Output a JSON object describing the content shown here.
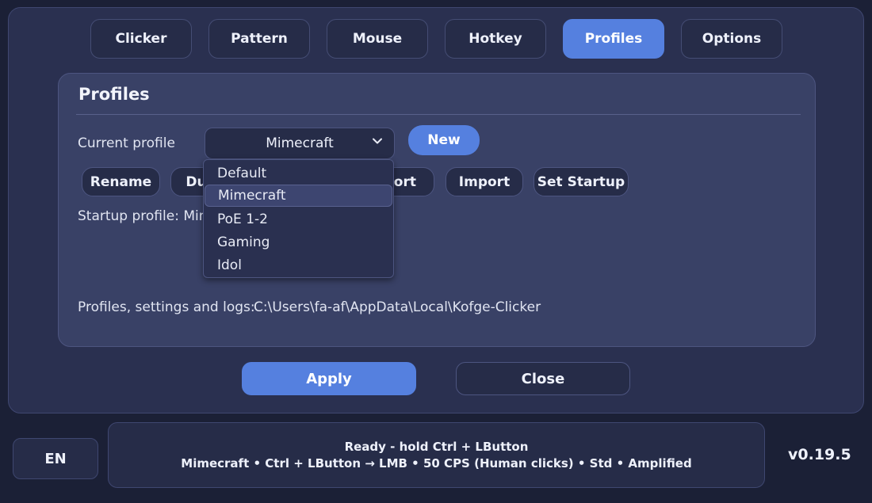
{
  "tabs": [
    "Clicker",
    "Pattern",
    "Mouse",
    "Hotkey",
    "Profiles",
    "Options"
  ],
  "active_tab": "Profiles",
  "accent_color": "#5580df",
  "profiles": {
    "title": "Profiles",
    "current_profile_label": "Current profile",
    "current_profile_value": "Mimecraft",
    "new_button": "New",
    "actions": [
      "Rename",
      "Duplicate",
      "Export",
      "Import",
      "Set Startup"
    ],
    "startup_label": "Startup profile: Mimecraft",
    "path_label": "Profiles, settings and logs:",
    "path_value": "C:\\Users\\fa-af\\AppData\\Local\\Kofge-Clicker",
    "dropdown_options": [
      "Default",
      "Mimecraft",
      "PoE 1-2",
      "Gaming",
      "Idol"
    ],
    "dropdown_selected": "Mimecraft"
  },
  "footer_buttons": {
    "apply": "Apply",
    "close": "Close"
  },
  "statusbar": {
    "language": "EN",
    "line1": "Ready - hold Ctrl + LButton",
    "line2": "Mimecraft  •  Ctrl + LButton → LMB  •  50 CPS (Human clicks)  •  Std  •  Amplified",
    "version": "v0.19.5"
  },
  "icons": {
    "combo_chevron": "chevron-down-icon"
  }
}
